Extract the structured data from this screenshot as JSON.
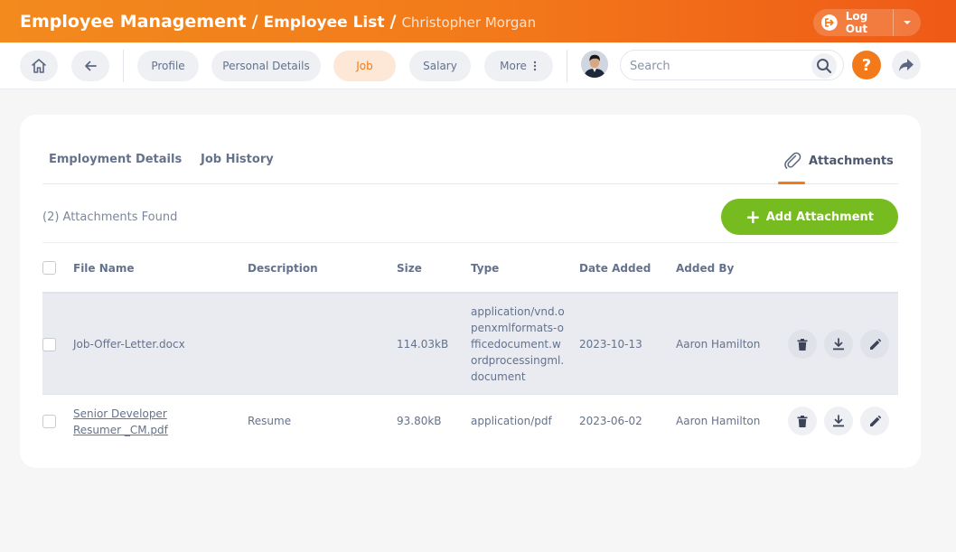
{
  "header": {
    "breadcrumb": {
      "root": "Employee Management",
      "sep1": "/",
      "list": "Employee List",
      "sep2": "/",
      "current": "Christopher Morgan"
    },
    "logout_label": "Log Out"
  },
  "nav": {
    "tabs": [
      {
        "label": "Profile"
      },
      {
        "label": "Personal Details"
      },
      {
        "label": "Job"
      },
      {
        "label": "Salary"
      },
      {
        "label": "More"
      }
    ],
    "search_placeholder": "Search",
    "help_label": "?"
  },
  "subtabs": {
    "employment": "Employment Details",
    "history": "Job History",
    "attachments": "Attachments"
  },
  "attachments": {
    "count_text": "(2) Attachments Found",
    "add_label": "Add Attachment",
    "columns": [
      "File Name",
      "Description",
      "Size",
      "Type",
      "Date Added",
      "Added By"
    ],
    "rows": [
      {
        "file_name": "Job-Offer-Letter.docx",
        "description": "",
        "size": "114.03kB",
        "type": "application/vnd.openxmlformats-officedocument.wordprocessingml.document",
        "date_added": "2023-10-13",
        "added_by": "Aaron Hamilton"
      },
      {
        "file_name": "Senior Developer Resumer _CM.pdf",
        "description": "Resume",
        "size": "93.80kB",
        "type": "application/pdf",
        "date_added": "2023-06-02",
        "added_by": "Aaron Hamilton"
      }
    ]
  },
  "colors": {
    "accent": "#f37a1a",
    "add_button": "#76bc21"
  }
}
